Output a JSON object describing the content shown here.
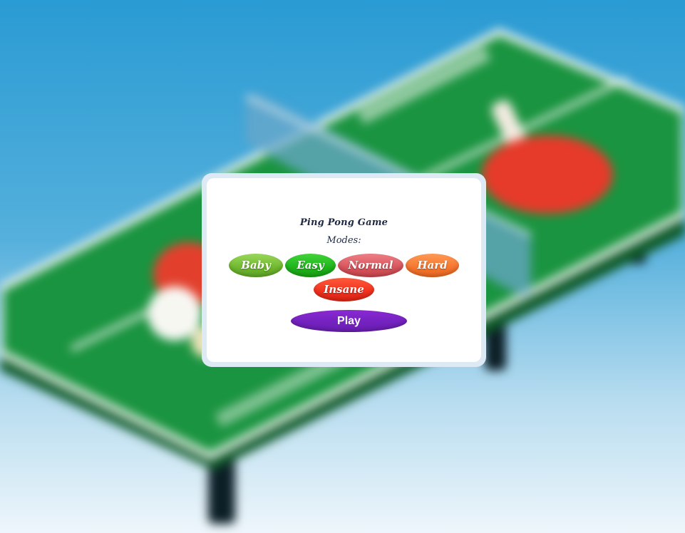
{
  "game": {
    "title": "Ping Pong Game",
    "modes_label": "Modes:"
  },
  "modes": [
    {
      "id": "baby",
      "label": "Baby",
      "color": "#6fb82e"
    },
    {
      "id": "easy",
      "label": "Easy",
      "color": "#1fb41c"
    },
    {
      "id": "normal",
      "label": "Normal",
      "color": "#d8545b"
    },
    {
      "id": "hard",
      "label": "Hard",
      "color": "#f5762e"
    },
    {
      "id": "insane",
      "label": "Insane",
      "color": "#f0301e"
    }
  ],
  "play": {
    "label": "Play",
    "color": "#7422c0"
  },
  "background": {
    "scene": "blurred ping pong table with red paddles and white balls",
    "table_color": "#1a9440",
    "sky_color": "#2a9bd3"
  }
}
